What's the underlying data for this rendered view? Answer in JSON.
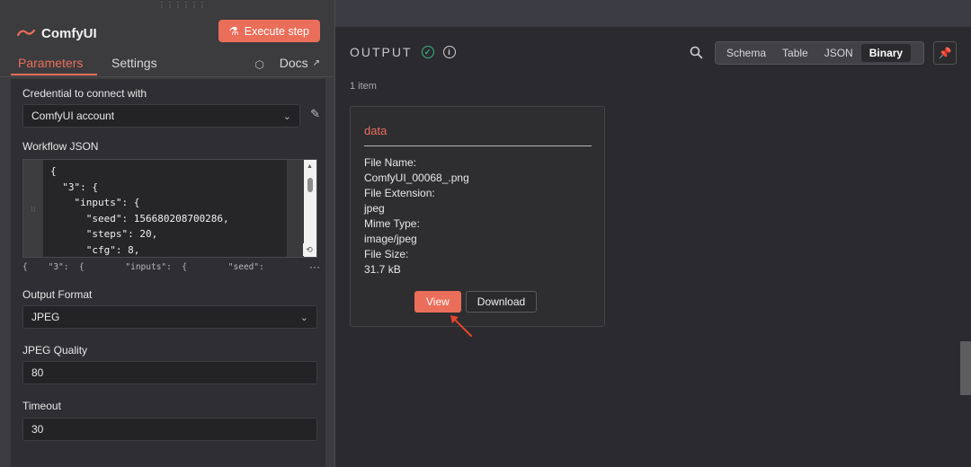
{
  "node": {
    "title": "ComfyUI",
    "execute_label": "Execute step",
    "tabs": [
      "Parameters",
      "Settings"
    ],
    "docs_label": "Docs"
  },
  "params": {
    "credential": {
      "label": "Credential to connect with",
      "value": "ComfyUI account"
    },
    "workflow": {
      "label": "Workflow JSON",
      "code": "{\n  \"3\": {\n    \"inputs\": {\n      \"seed\": 156680208700286,\n      \"steps\": 20,\n      \"cfg\": 8,",
      "preview": "{    \"3\":  {        \"inputs\":  {        \"seed\":"
    },
    "output_format": {
      "label": "Output Format",
      "value": "JPEG"
    },
    "jpeg_quality": {
      "label": "JPEG Quality",
      "value": "80"
    },
    "timeout": {
      "label": "Timeout",
      "value": "30"
    }
  },
  "output": {
    "title": "OUTPUT",
    "views": [
      "Schema",
      "Table",
      "JSON",
      "Binary"
    ],
    "active_view": "Binary",
    "item_count": "1 item",
    "card": {
      "key": "data",
      "meta": [
        {
          "label": "File Name:",
          "value": "ComfyUI_00068_.png"
        },
        {
          "label": "File Extension:",
          "value": "jpeg"
        },
        {
          "label": "Mime Type:",
          "value": "image/jpeg"
        },
        {
          "label": "File Size:",
          "value": "31.7 kB"
        }
      ],
      "view_label": "View",
      "download_label": "Download"
    }
  },
  "colors": {
    "accent": "#ea6e5a",
    "success": "#36b37e"
  }
}
